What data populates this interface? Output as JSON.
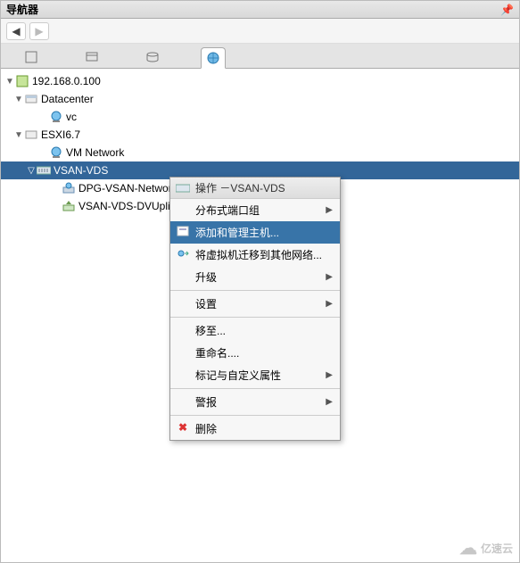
{
  "panel": {
    "title": "导航器"
  },
  "tree": {
    "root_ip": "192.168.0.100",
    "datacenter": "Datacenter",
    "vc": "vc",
    "esxi": "ESXI6.7",
    "vmnet": "VM Network",
    "vds": "VSAN-VDS",
    "dpg": "DPG-VSAN-Network",
    "uplink": "VSAN-VDS-DVUplir"
  },
  "ctx": {
    "header": "操作 －VSAN-VDS",
    "pg": "分布式端口组",
    "addhost": "添加和管理主机...",
    "migrate": "将虚拟机迁移到其他网络...",
    "upgrade": "升级",
    "settings": "设置",
    "moveto": "移至...",
    "rename": "重命名....",
    "tags": "标记与自定义属性",
    "alarms": "警报",
    "delete": "删除"
  },
  "brand": "亿速云"
}
